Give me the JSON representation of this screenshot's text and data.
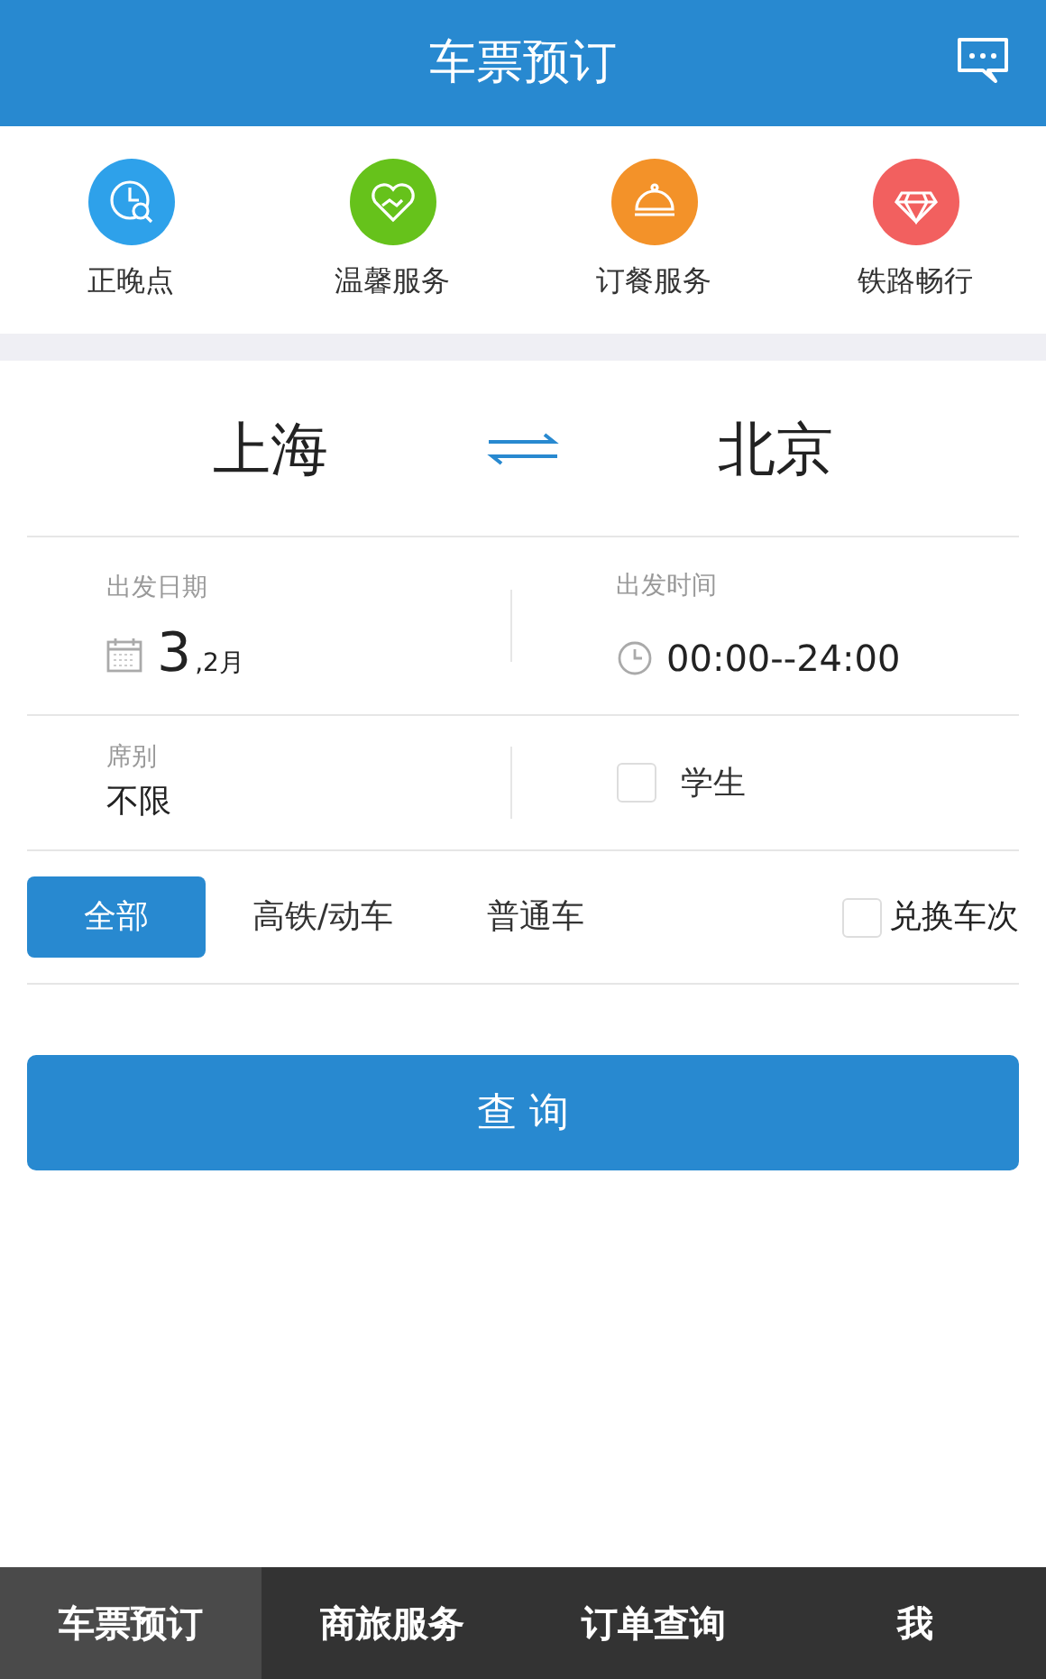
{
  "header": {
    "title": "车票预订"
  },
  "shortcuts": [
    {
      "label": "正晚点",
      "kind": "clock",
      "color": "#2ea1ea"
    },
    {
      "label": "温馨服务",
      "kind": "heart",
      "color": "#66c21b"
    },
    {
      "label": "订餐服务",
      "kind": "dish",
      "color": "#f39229"
    },
    {
      "label": "铁路畅行",
      "kind": "gem",
      "color": "#f2605f"
    }
  ],
  "route": {
    "from": "上海",
    "to": "北京"
  },
  "date": {
    "label": "出发日期",
    "day": "3",
    "month": ",2月"
  },
  "time": {
    "label": "出发时间",
    "value": "00:00--24:00"
  },
  "seat": {
    "label": "席别",
    "value": "不限"
  },
  "student": {
    "label": "学生",
    "checked": false
  },
  "train_types": [
    {
      "label": "全部",
      "selected": true
    },
    {
      "label": "高铁/动车",
      "selected": false
    },
    {
      "label": "普通车",
      "selected": false
    }
  ],
  "exchange": {
    "label": "兑换车次",
    "checked": false
  },
  "search_button": "查 询",
  "bottom_tabs": [
    {
      "label": "车票预订",
      "selected": true
    },
    {
      "label": "商旅服务",
      "selected": false
    },
    {
      "label": "订单查询",
      "selected": false
    },
    {
      "label": "我",
      "selected": false
    }
  ]
}
